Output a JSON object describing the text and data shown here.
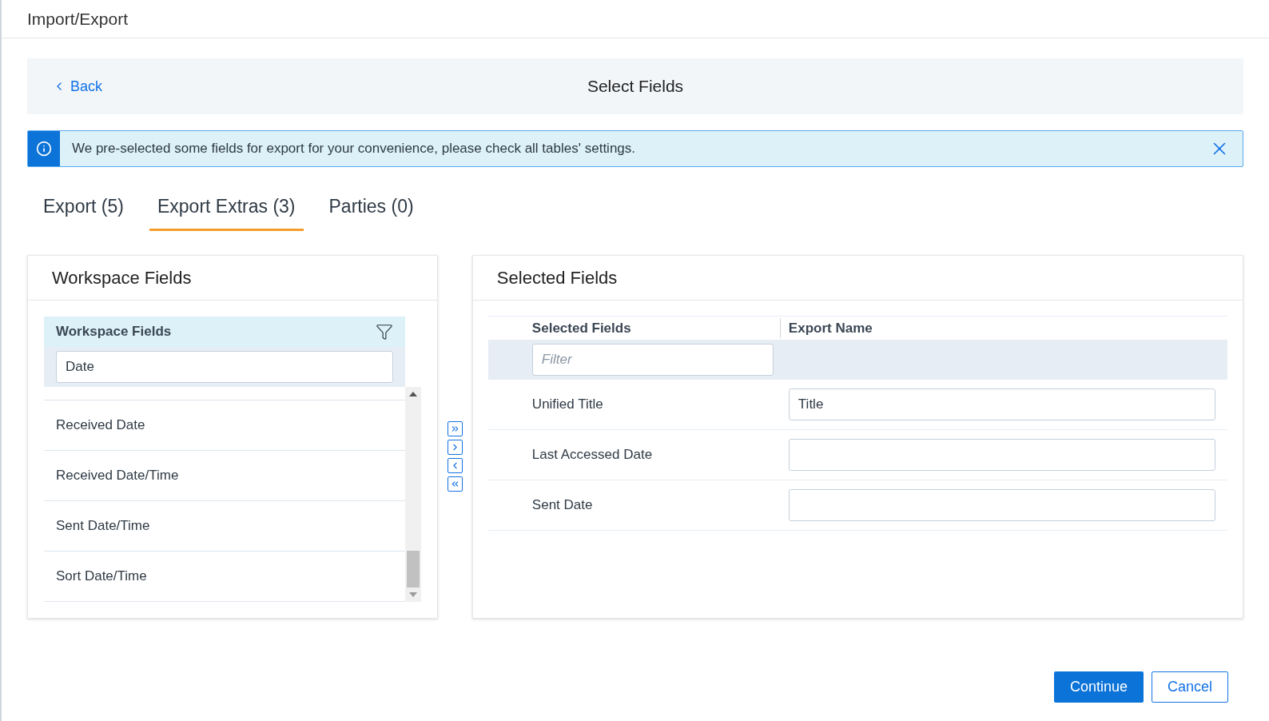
{
  "window": {
    "title": "Import/Export"
  },
  "header": {
    "back": "Back",
    "title": "Select Fields"
  },
  "alert": {
    "message": "We pre-selected some fields for export for your convenience, please check all tables' settings."
  },
  "tabs": [
    {
      "label": "Export (5)",
      "selected": false
    },
    {
      "label": "Export Extras (3)",
      "selected": true
    },
    {
      "label": "Parties (0)",
      "selected": false
    }
  ],
  "workspace_panel": {
    "title": "Workspace Fields",
    "column": "Workspace Fields",
    "filter_value": "Date",
    "items": [
      "Received Date",
      "Received Date/Time",
      "Sent Date/Time",
      "Sort Date/Time"
    ]
  },
  "selected_panel": {
    "title": "Selected Fields",
    "columns": [
      "Selected Fields",
      "Export Name"
    ],
    "filter_placeholder": "Filter",
    "rows": [
      {
        "field": "Unified Title",
        "export_name": "Title"
      },
      {
        "field": "Last Accessed Date",
        "export_name": ""
      },
      {
        "field": "Sent Date",
        "export_name": ""
      }
    ]
  },
  "buttons": {
    "continue": "Continue",
    "cancel": "Cancel"
  }
}
